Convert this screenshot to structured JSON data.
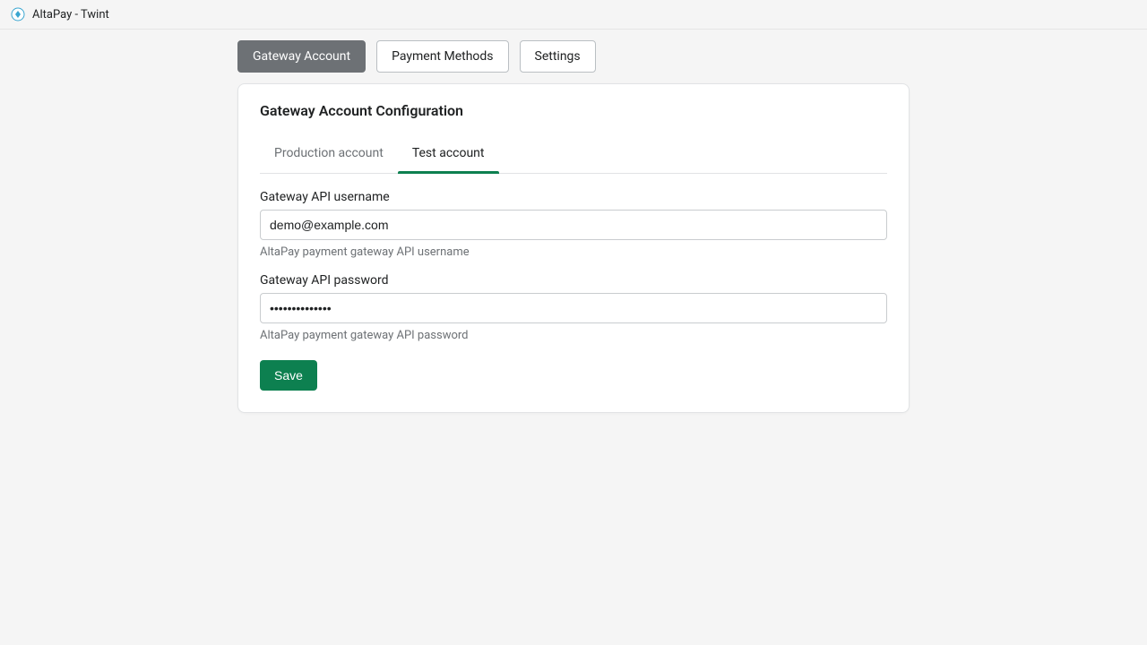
{
  "header": {
    "app_title": "AltaPay - Twint"
  },
  "nav": {
    "gateway_account": "Gateway Account",
    "payment_methods": "Payment Methods",
    "settings": "Settings"
  },
  "card": {
    "title": "Gateway Account Configuration",
    "subtabs": {
      "production": "Production account",
      "test": "Test account"
    },
    "fields": {
      "username": {
        "label": "Gateway API username",
        "value": "demo@example.com",
        "help": "AltaPay payment gateway API username"
      },
      "password": {
        "label": "Gateway API password",
        "value": "••••••••••••••",
        "help": "AltaPay payment gateway API password"
      }
    },
    "save_label": "Save"
  }
}
